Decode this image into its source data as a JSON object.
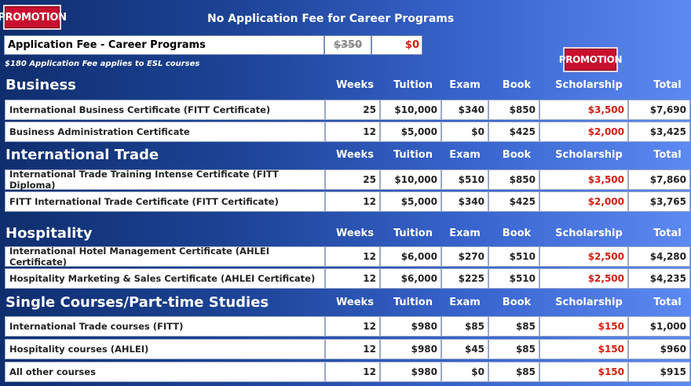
{
  "promo_badge": "PROMOTION",
  "headline": "No Application Fee for Career Programs",
  "fee": {
    "label": "Application Fee - Career Programs",
    "old_price": "$350",
    "new_price": "$0"
  },
  "esl_note": "$180 Application Fee applies to ESL courses",
  "columns": [
    "Weeks",
    "Tuition",
    "Exam",
    "Book",
    "Scholarship",
    "Total"
  ],
  "sections": [
    {
      "title": "Business",
      "rows": [
        {
          "name": "International Business Certificate (FITT Certificate)",
          "weeks": "25",
          "tuition": "$10,000",
          "exam": "$340",
          "book": "$850",
          "scholarship": "$3,500",
          "total": "$7,690"
        },
        {
          "name": "Business Administration Certificate",
          "weeks": "12",
          "tuition": "$5,000",
          "exam": "$0",
          "book": "$425",
          "scholarship": "$2,000",
          "total": "$3,425"
        }
      ]
    },
    {
      "title": "International Trade",
      "rows": [
        {
          "name": "International Trade Training Intense Certificate (FITT Diploma)",
          "weeks": "25",
          "tuition": "$10,000",
          "exam": "$510",
          "book": "$850",
          "scholarship": "$3,500",
          "total": "$7,860"
        },
        {
          "name": "FITT International Trade Certificate (FITT Certificate)",
          "weeks": "12",
          "tuition": "$5,000",
          "exam": "$340",
          "book": "$425",
          "scholarship": "$2,000",
          "total": "$3,765"
        }
      ]
    },
    {
      "title": "Hospitality",
      "rows": [
        {
          "name": "International Hotel Management Certificate (AHLEI Certificate)",
          "weeks": "12",
          "tuition": "$6,000",
          "exam": "$270",
          "book": "$510",
          "scholarship": "$2,500",
          "total": "$4,280"
        },
        {
          "name": "Hospitality Marketing & Sales Certificate  (AHLEI Certificate)",
          "weeks": "12",
          "tuition": "$6,000",
          "exam": "$225",
          "book": "$510",
          "scholarship": "$2,500",
          "total": "$4,235"
        }
      ]
    },
    {
      "title": "Single Courses/Part-time Studies",
      "rows": [
        {
          "name": "International Trade courses (FITT)",
          "weeks": "12",
          "tuition": "$980",
          "exam": "$85",
          "book": "$85",
          "scholarship": "$150",
          "total": "$1,000"
        },
        {
          "name": "Hospitality courses (AHLEI)",
          "weeks": "12",
          "tuition": "$980",
          "exam": "$45",
          "book": "$85",
          "scholarship": "$150",
          "total": "$960"
        },
        {
          "name": "All other courses",
          "weeks": "12",
          "tuition": "$980",
          "exam": "$0",
          "book": "$85",
          "scholarship": "$150",
          "total": "$915"
        }
      ]
    }
  ]
}
